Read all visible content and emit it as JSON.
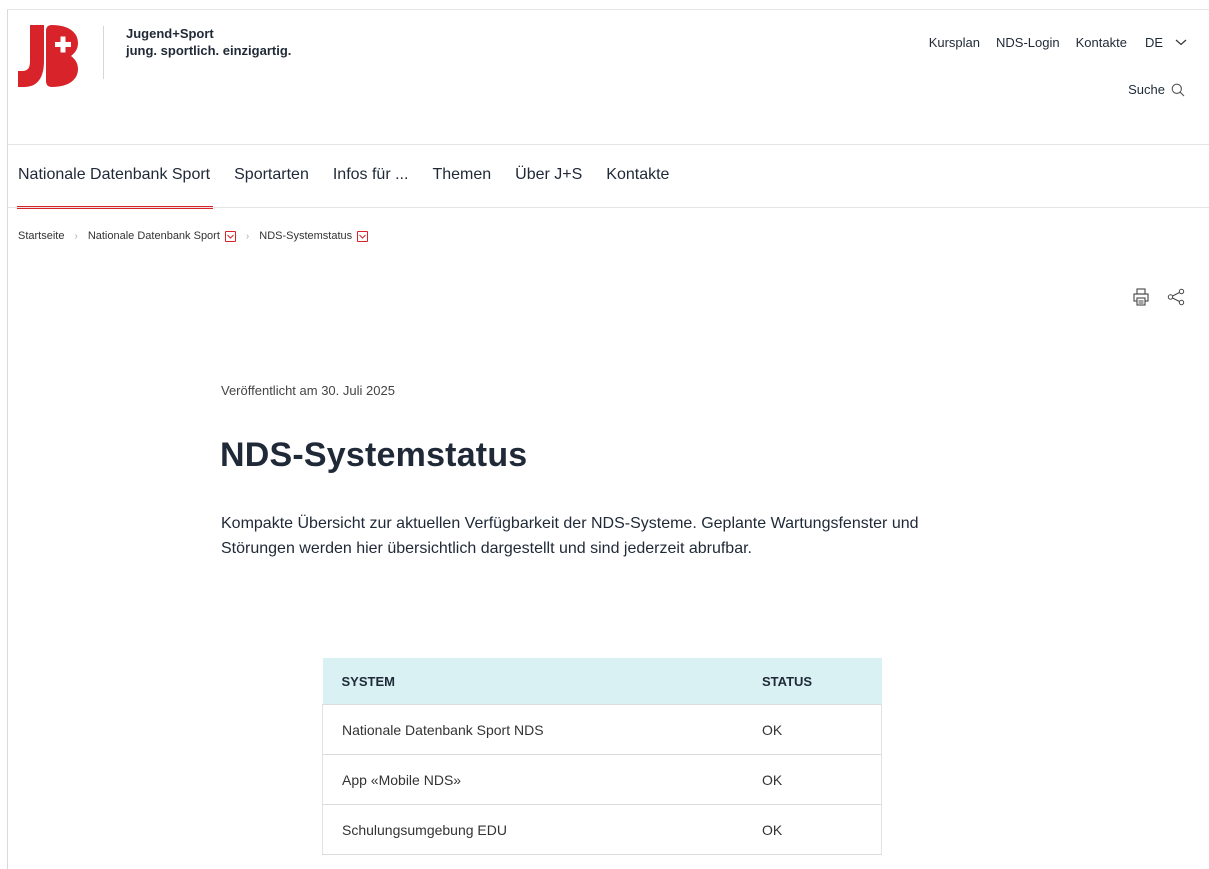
{
  "brand": {
    "name": "Jugend+Sport",
    "tagline": "jung. sportlich. einzigartig."
  },
  "service_nav": {
    "links": [
      "Kursplan",
      "NDS-Login",
      "Kontakte"
    ],
    "language": "DE"
  },
  "search": {
    "label": "Suche"
  },
  "main_nav": {
    "items": [
      "Nationale Datenbank Sport",
      "Sportarten",
      "Infos für ...",
      "Themen",
      "Über J+S",
      "Kontakte"
    ],
    "active": "Nationale Datenbank Sport"
  },
  "breadcrumb": {
    "items": [
      "Startseite",
      "Nationale Datenbank Sport",
      "NDS-Systemstatus"
    ]
  },
  "article": {
    "published": "Veröffentlicht am 30. Juli 2025",
    "title": "NDS-Systemstatus",
    "intro": "Kompakte Übersicht zur aktuellen Verfügbarkeit der NDS-Systeme. Geplante Wartungsfenster und Störungen werden hier übersichtlich dargestellt und sind jederzeit abrufbar."
  },
  "status_table": {
    "headers": [
      "SYSTEM",
      "STATUS"
    ],
    "rows": [
      [
        "Nationale Datenbank Sport NDS",
        "OK"
      ],
      [
        "App «Mobile NDS»",
        "OK"
      ],
      [
        "Schulungsumgebung EDU",
        "OK"
      ]
    ]
  },
  "colors": {
    "brand_red": "#d8232a",
    "table_header_bg": "#d9f1f2"
  }
}
